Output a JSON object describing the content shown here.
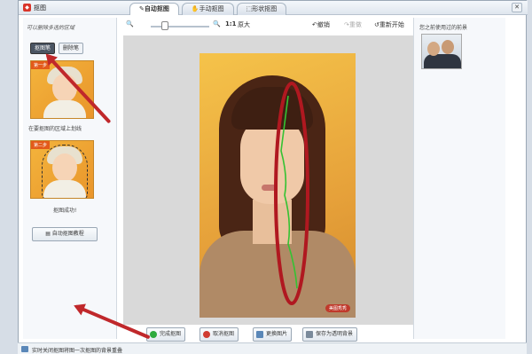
{
  "app": {
    "title": "抠图"
  },
  "tabs": [
    {
      "label": "自动抠图",
      "icon": "brush-icon"
    },
    {
      "label": "手动抠图",
      "icon": "hand-icon"
    },
    {
      "label": "形状抠图",
      "icon": "shape-icon"
    }
  ],
  "left_panel": {
    "handwriting": "可以删除多选的区域",
    "mode_buttons": [
      "抠图笔",
      "删除笔"
    ],
    "step1_badge": "第一步",
    "step1_caption": "在要抠图的区域上划线",
    "step2_badge": "第二步",
    "step2_caption": "抠图成功!",
    "tutorial_button": "自动抠图教程"
  },
  "toolbar": {
    "zoom_ratio": "1:1",
    "original_size": "原大",
    "undo": "撤销",
    "redo": "重做",
    "restart": "重新开始"
  },
  "canvas": {
    "watermark": "美图秀秀"
  },
  "actions": {
    "complete": "完成抠图",
    "cancel": "取消抠图",
    "replace_image": "更换图片",
    "save_transparent": "保存为透明背景"
  },
  "right_panel": {
    "recent_title": "您之前使用过的前景"
  },
  "status_bar": {
    "text": "实时关闭抠图将图一次抠图的背景重叠"
  },
  "colors": {
    "annotation_red": "#c0282b",
    "complete_green": "#2eaa3e",
    "cancel_red": "#d03b31"
  }
}
